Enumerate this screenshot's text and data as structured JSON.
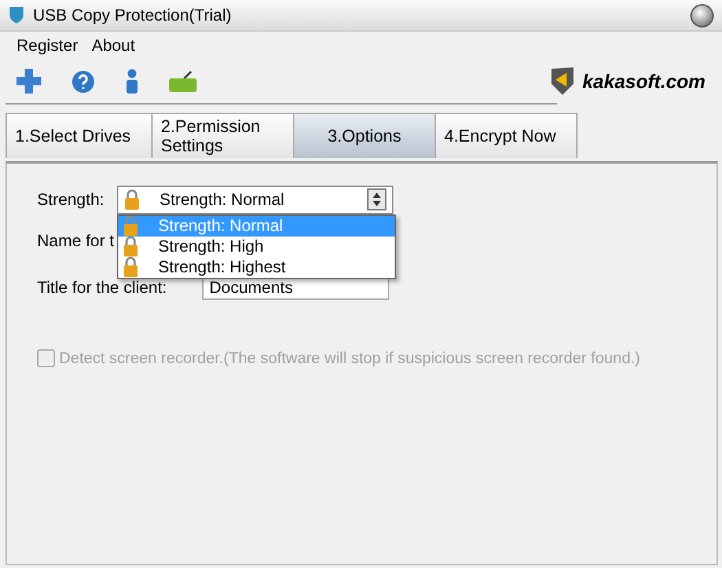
{
  "window": {
    "title": "USB Copy Protection(Trial)"
  },
  "menu": [
    "Register",
    "About"
  ],
  "logo": {
    "text": "kakasoft.com"
  },
  "tabs": [
    {
      "label": "1.Select Drives",
      "selected": false
    },
    {
      "label": "2.Permission\nSettings",
      "selected": false
    },
    {
      "label": "3.Options",
      "selected": true
    },
    {
      "label": "4.Encrypt Now",
      "selected": false
    }
  ],
  "options": {
    "strength": {
      "label": "Strength:",
      "value": "Strength: Normal",
      "expanded": true,
      "items": [
        {
          "label": "Strength: Normal",
          "selected": true
        },
        {
          "label": "Strength: High",
          "selected": false
        },
        {
          "label": "Strength: Highest",
          "selected": false
        }
      ]
    },
    "name_label": "Name for t",
    "title": {
      "label": "Title for the client:",
      "value": "Documents"
    },
    "detect": {
      "label": "Detect screen recorder.(The software will stop if suspicious screen recorder found.)",
      "checked": false,
      "disabled": true
    }
  }
}
